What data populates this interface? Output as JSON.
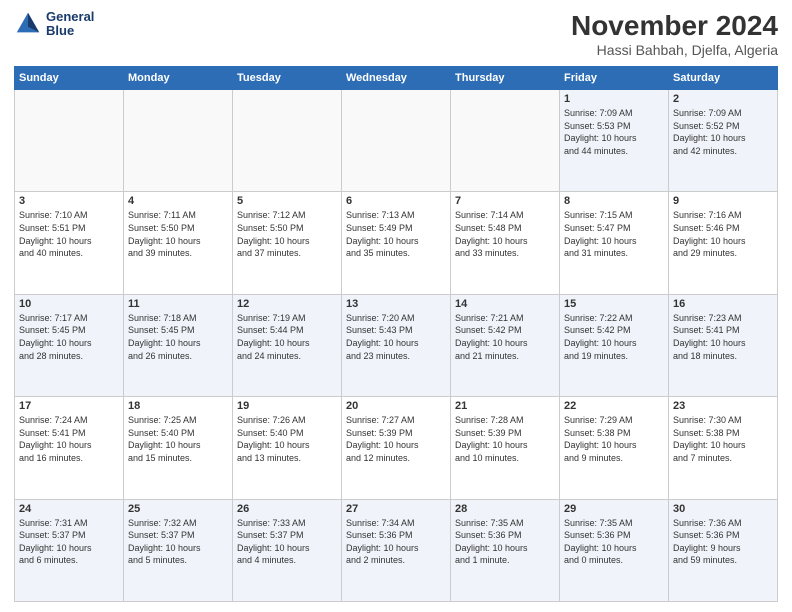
{
  "header": {
    "logo_line1": "General",
    "logo_line2": "Blue",
    "month": "November 2024",
    "location": "Hassi Bahbah, Djelfa, Algeria"
  },
  "days_of_week": [
    "Sunday",
    "Monday",
    "Tuesday",
    "Wednesday",
    "Thursday",
    "Friday",
    "Saturday"
  ],
  "weeks": [
    [
      {
        "day": "",
        "info": ""
      },
      {
        "day": "",
        "info": ""
      },
      {
        "day": "",
        "info": ""
      },
      {
        "day": "",
        "info": ""
      },
      {
        "day": "",
        "info": ""
      },
      {
        "day": "1",
        "info": "Sunrise: 7:09 AM\nSunset: 5:53 PM\nDaylight: 10 hours\nand 44 minutes."
      },
      {
        "day": "2",
        "info": "Sunrise: 7:09 AM\nSunset: 5:52 PM\nDaylight: 10 hours\nand 42 minutes."
      }
    ],
    [
      {
        "day": "3",
        "info": "Sunrise: 7:10 AM\nSunset: 5:51 PM\nDaylight: 10 hours\nand 40 minutes."
      },
      {
        "day": "4",
        "info": "Sunrise: 7:11 AM\nSunset: 5:50 PM\nDaylight: 10 hours\nand 39 minutes."
      },
      {
        "day": "5",
        "info": "Sunrise: 7:12 AM\nSunset: 5:50 PM\nDaylight: 10 hours\nand 37 minutes."
      },
      {
        "day": "6",
        "info": "Sunrise: 7:13 AM\nSunset: 5:49 PM\nDaylight: 10 hours\nand 35 minutes."
      },
      {
        "day": "7",
        "info": "Sunrise: 7:14 AM\nSunset: 5:48 PM\nDaylight: 10 hours\nand 33 minutes."
      },
      {
        "day": "8",
        "info": "Sunrise: 7:15 AM\nSunset: 5:47 PM\nDaylight: 10 hours\nand 31 minutes."
      },
      {
        "day": "9",
        "info": "Sunrise: 7:16 AM\nSunset: 5:46 PM\nDaylight: 10 hours\nand 29 minutes."
      }
    ],
    [
      {
        "day": "10",
        "info": "Sunrise: 7:17 AM\nSunset: 5:45 PM\nDaylight: 10 hours\nand 28 minutes."
      },
      {
        "day": "11",
        "info": "Sunrise: 7:18 AM\nSunset: 5:45 PM\nDaylight: 10 hours\nand 26 minutes."
      },
      {
        "day": "12",
        "info": "Sunrise: 7:19 AM\nSunset: 5:44 PM\nDaylight: 10 hours\nand 24 minutes."
      },
      {
        "day": "13",
        "info": "Sunrise: 7:20 AM\nSunset: 5:43 PM\nDaylight: 10 hours\nand 23 minutes."
      },
      {
        "day": "14",
        "info": "Sunrise: 7:21 AM\nSunset: 5:42 PM\nDaylight: 10 hours\nand 21 minutes."
      },
      {
        "day": "15",
        "info": "Sunrise: 7:22 AM\nSunset: 5:42 PM\nDaylight: 10 hours\nand 19 minutes."
      },
      {
        "day": "16",
        "info": "Sunrise: 7:23 AM\nSunset: 5:41 PM\nDaylight: 10 hours\nand 18 minutes."
      }
    ],
    [
      {
        "day": "17",
        "info": "Sunrise: 7:24 AM\nSunset: 5:41 PM\nDaylight: 10 hours\nand 16 minutes."
      },
      {
        "day": "18",
        "info": "Sunrise: 7:25 AM\nSunset: 5:40 PM\nDaylight: 10 hours\nand 15 minutes."
      },
      {
        "day": "19",
        "info": "Sunrise: 7:26 AM\nSunset: 5:40 PM\nDaylight: 10 hours\nand 13 minutes."
      },
      {
        "day": "20",
        "info": "Sunrise: 7:27 AM\nSunset: 5:39 PM\nDaylight: 10 hours\nand 12 minutes."
      },
      {
        "day": "21",
        "info": "Sunrise: 7:28 AM\nSunset: 5:39 PM\nDaylight: 10 hours\nand 10 minutes."
      },
      {
        "day": "22",
        "info": "Sunrise: 7:29 AM\nSunset: 5:38 PM\nDaylight: 10 hours\nand 9 minutes."
      },
      {
        "day": "23",
        "info": "Sunrise: 7:30 AM\nSunset: 5:38 PM\nDaylight: 10 hours\nand 7 minutes."
      }
    ],
    [
      {
        "day": "24",
        "info": "Sunrise: 7:31 AM\nSunset: 5:37 PM\nDaylight: 10 hours\nand 6 minutes."
      },
      {
        "day": "25",
        "info": "Sunrise: 7:32 AM\nSunset: 5:37 PM\nDaylight: 10 hours\nand 5 minutes."
      },
      {
        "day": "26",
        "info": "Sunrise: 7:33 AM\nSunset: 5:37 PM\nDaylight: 10 hours\nand 4 minutes."
      },
      {
        "day": "27",
        "info": "Sunrise: 7:34 AM\nSunset: 5:36 PM\nDaylight: 10 hours\nand 2 minutes."
      },
      {
        "day": "28",
        "info": "Sunrise: 7:35 AM\nSunset: 5:36 PM\nDaylight: 10 hours\nand 1 minute."
      },
      {
        "day": "29",
        "info": "Sunrise: 7:35 AM\nSunset: 5:36 PM\nDaylight: 10 hours\nand 0 minutes."
      },
      {
        "day": "30",
        "info": "Sunrise: 7:36 AM\nSunset: 5:36 PM\nDaylight: 9 hours\nand 59 minutes."
      }
    ]
  ]
}
